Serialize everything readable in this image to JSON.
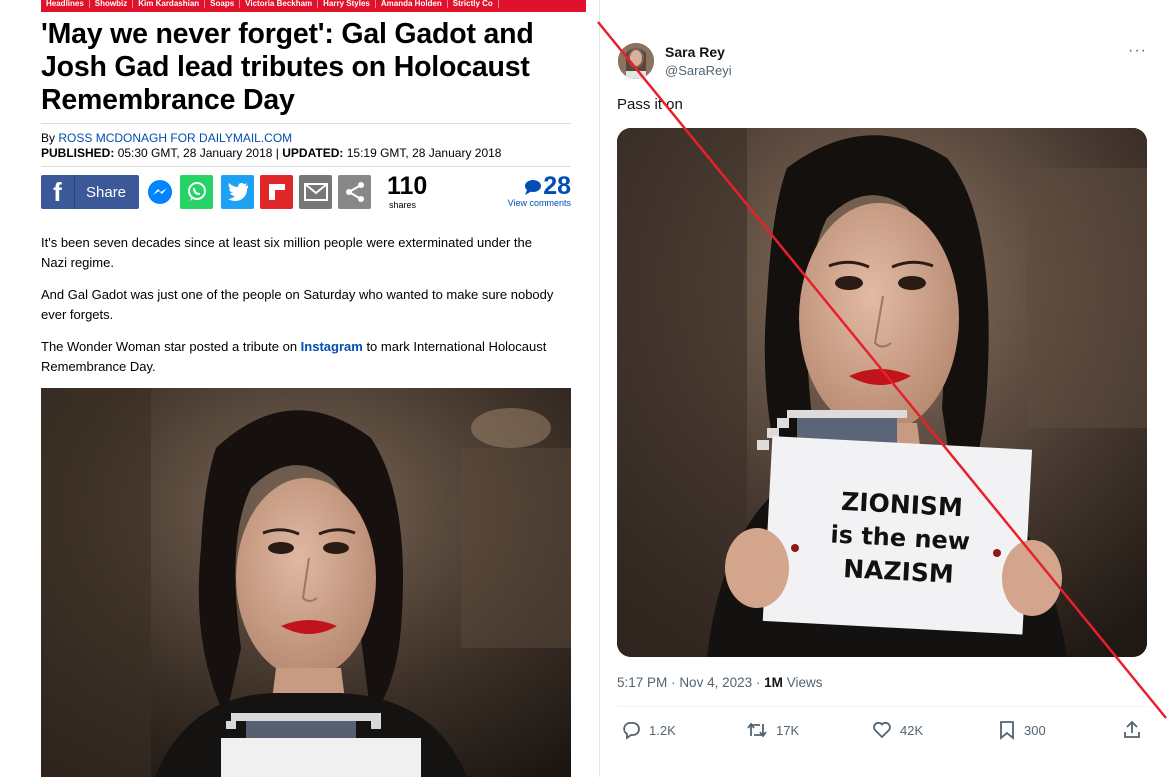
{
  "colors": {
    "dm_red": "#e0112b",
    "dm_link_blue": "#004db3",
    "facebook_blue": "#3b5998",
    "messenger_blue": "#0084ff",
    "whatsapp_green": "#25d366",
    "twitter_blue": "#1da1f2",
    "flipboard_red": "#e12828",
    "email_grey": "#777777",
    "share_grey": "#888888",
    "strike_red": "#e8202a",
    "tweet_text": "#0f1419",
    "tweet_muted": "#536471"
  },
  "article": {
    "topnav": [
      "Headlines",
      "Showbiz",
      "Kim Kardashian",
      "Soaps",
      "Victoria Beckham",
      "Harry Styles",
      "Amanda Holden",
      "Strictly Co"
    ],
    "headline": "'May we never forget': Gal Gadot and Josh Gad lead tributes on Holocaust Remembrance Day",
    "byline_prefix": "By",
    "byline_author": "ROSS MCDONAGH FOR DAILYMAIL.COM",
    "published_label": "PUBLISHED:",
    "published_value": "05:30 GMT, 28 January 2018",
    "separator": "|",
    "updated_label": "UPDATED:",
    "updated_value": "15:19 GMT, 28 January 2018",
    "share": {
      "facebook_label": "Share",
      "share_count": "110",
      "share_count_label": "shares",
      "comment_count": "28",
      "comment_label": "View comments"
    },
    "paragraphs": {
      "p1": "It's been seven decades since at least six million people were exterminated under the Nazi regime.",
      "p2": "And Gal Gadot was just one of the people on Saturday who wanted to make sure nobody ever forgets.",
      "p3_before": "The Wonder Woman star posted a tribute on",
      "p3_link": "Instagram",
      "p3_after": "to mark International Holocaust Remembrance Day."
    }
  },
  "tweet": {
    "display_name": "Sara Rey",
    "handle": "@SaraReyi",
    "more": "···",
    "text": "Pass it on",
    "sign": {
      "line1": "ZIONISM",
      "line2": "is the new",
      "line3": "NAZISM"
    },
    "time": "5:17 PM",
    "date": "Nov 4, 2023",
    "views_count": "1M",
    "views_label": "Views",
    "dot": "·",
    "actions": {
      "replies": "1.2K",
      "reposts": "17K",
      "likes": "42K",
      "bookmarks": "300"
    }
  }
}
